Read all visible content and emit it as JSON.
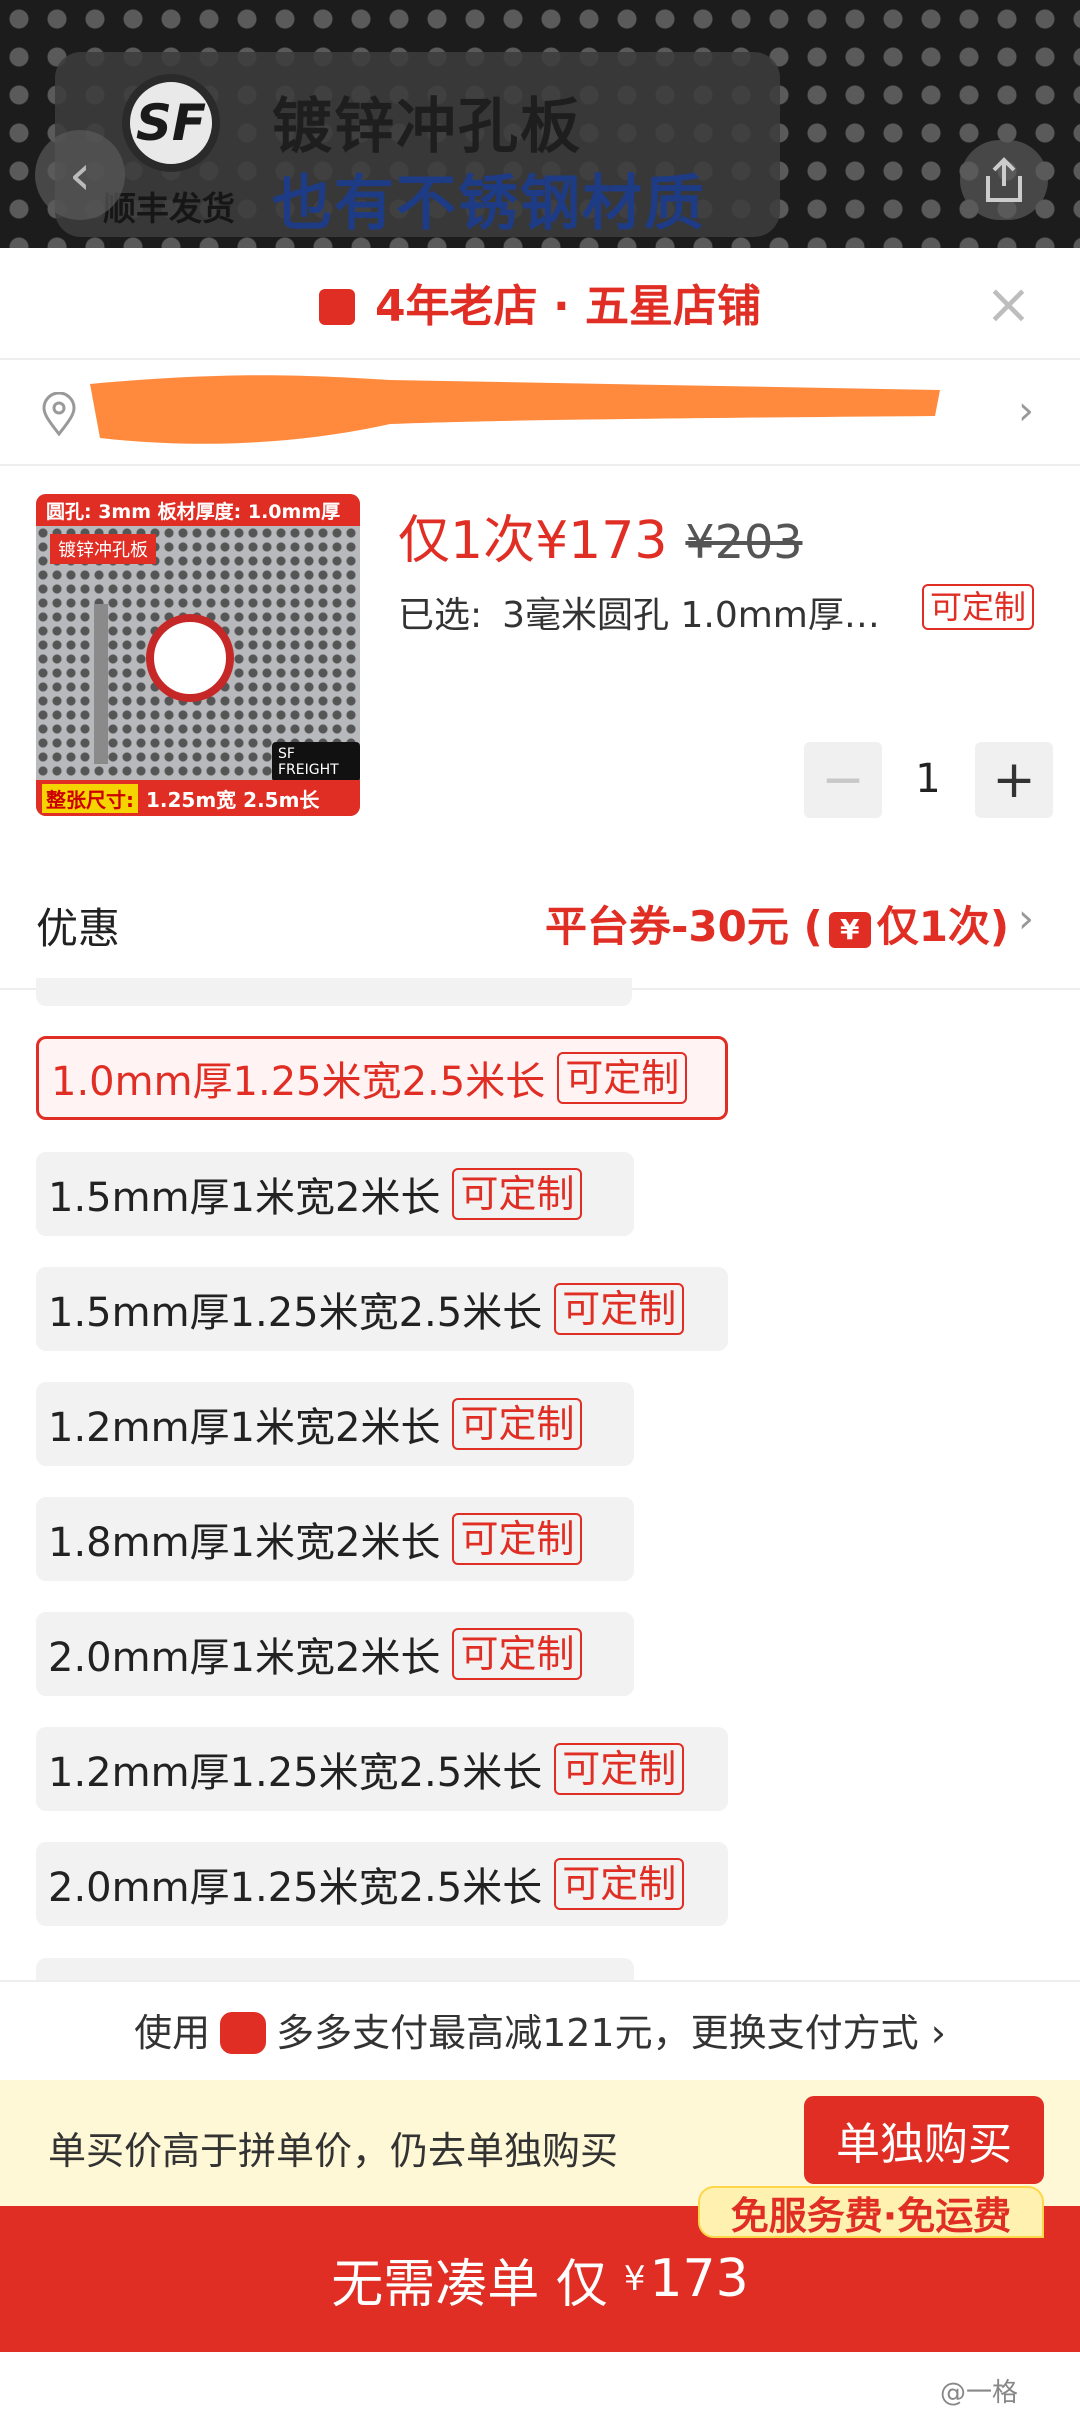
{
  "banner": {
    "sf_logo": "SF",
    "sf_text": "顺丰发货",
    "line1": "镀锌冲孔板",
    "line2": "也有不锈钢材质"
  },
  "header": {
    "store": "4年老店 · 五星店铺",
    "close": "×"
  },
  "address": {
    "arrow": "›"
  },
  "product": {
    "thumb_top": "圆孔: 3mm 板材厚度: 1.0mm厚",
    "thumb_label": "镀锌冲孔板",
    "thumb_sf": "SF FREIGHT",
    "thumb_bottom_key": "整张尺寸:",
    "thumb_bottom_val": "1.25m宽 2.5m长",
    "price": "仅1次¥173",
    "price_old": "¥203",
    "selected_label": "已选:",
    "selected_value": "3毫米圆孔 1.0mm厚…",
    "selected_tag": "可定制",
    "quantity": "1",
    "minus": "−",
    "plus": "+"
  },
  "promo": {
    "label": "优惠",
    "value_prefix": "平台券-30元 (",
    "yen_icon": "¥",
    "value_suffix": "仅1次)",
    "arrow": "›"
  },
  "options": [
    {
      "label": "1.0mm厚1.25米宽2.5米长",
      "tag": "可定制"
    },
    {
      "label": "1.5mm厚1米宽2米长",
      "tag": "可定制"
    },
    {
      "label": "1.5mm厚1.25米宽2.5米长",
      "tag": "可定制"
    },
    {
      "label": "1.2mm厚1米宽2米长",
      "tag": "可定制"
    },
    {
      "label": "1.8mm厚1米宽2米长",
      "tag": "可定制"
    },
    {
      "label": "2.0mm厚1米宽2米长",
      "tag": "可定制"
    },
    {
      "label": "1.2mm厚1.25米宽2.5米长",
      "tag": "可定制"
    },
    {
      "label": "2.0mm厚1.25米宽2.5米长",
      "tag": "可定制"
    }
  ],
  "payment": {
    "use": "使用",
    "text": "多多支付最高减121元，更换支付方式",
    "arrow": "›"
  },
  "alone": {
    "hint": "单买价高于拼单价，仍去单独购买",
    "button": "单独购买",
    "badge": "免服务费·免运费"
  },
  "cta": {
    "text": "无需凑单 仅",
    "yen": "¥",
    "amount": "173"
  },
  "watermark": "@一格",
  "colors": {
    "accent": "#e02e24",
    "yellow_bg": "#fff8d6",
    "redaction": "#ff8a3d"
  }
}
